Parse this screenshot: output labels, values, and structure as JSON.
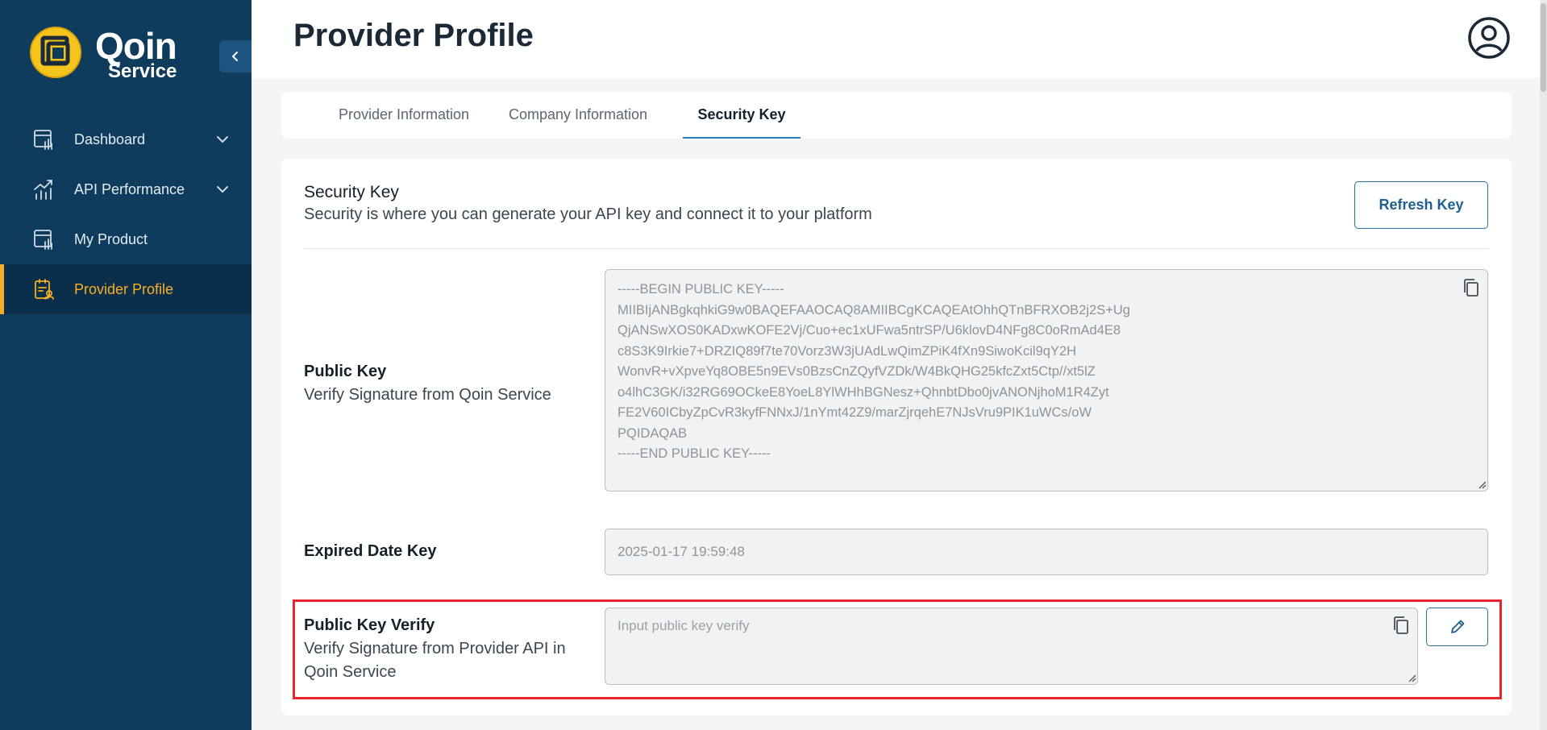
{
  "brand": {
    "name": "Qoin",
    "sub": "Service",
    "colors": {
      "sidebar": "#0f3b5c",
      "accent": "#f5b026",
      "primary": "#2a6f9e",
      "highlight": "#e8262e"
    }
  },
  "sidebar": {
    "items": [
      {
        "label": "Dashboard",
        "icon": "dashboard-icon",
        "expandable": true,
        "active": false
      },
      {
        "label": "API Performance",
        "icon": "chart-icon",
        "expandable": true,
        "active": false
      },
      {
        "label": "My Product",
        "icon": "product-icon",
        "expandable": false,
        "active": false
      },
      {
        "label": "Provider Profile",
        "icon": "profile-icon",
        "expandable": false,
        "active": true
      }
    ]
  },
  "header": {
    "title": "Provider Profile"
  },
  "tabs": [
    {
      "label": "Provider Information",
      "active": false
    },
    {
      "label": "Company Information",
      "active": false
    },
    {
      "label": "Security Key",
      "active": true
    }
  ],
  "security": {
    "title": "Security Key",
    "description": "Security is where you can generate your API key and connect it to your platform",
    "refresh_label": "Refresh Key",
    "public_key": {
      "label": "Public Key",
      "sublabel": "Verify Signature from Qoin Service",
      "value": "-----BEGIN PUBLIC KEY-----\nMIIBIjANBgkqhkiG9w0BAQEFAAOCAQ8AMIIBCgKCAQEAtOhhQTnBFRXOB2j2S+Ug\nQjANSwXOS0KADxwKOFE2Vj/Cuo+ec1xUFwa5ntrSP/U6klovD4NFg8C0oRmAd4E8\nc8S3K9Irkie7+DRZIQ89f7te70Vorz3W3jUAdLwQimZPiK4fXn9SiwoKcil9qY2H\nWonvR+vXpveYq8OBE5n9EVs0BzsCnZQyfVZDk/W4BkQHG25kfcZxt5Ctp//xt5lZ\no4lhC3GK/i32RG69OCkeE8YoeL8YlWHhBGNesz+QhnbtDbo0jvANONjhoM1R4Zyt\nFE2V60ICbyZpCvR3kyfFNNxJ/1nYmt42Z9/marZjrqehE7NJsVru9PIK1uWCs/oW\nPQIDAQAB\n-----END PUBLIC KEY-----"
    },
    "expired": {
      "label": "Expired Date Key",
      "value": "2025-01-17 19:59:48"
    },
    "verify": {
      "label": "Public Key Verify",
      "sublabel": "Verify Signature from Provider API in Qoin Service",
      "placeholder": "Input public key verify"
    }
  }
}
